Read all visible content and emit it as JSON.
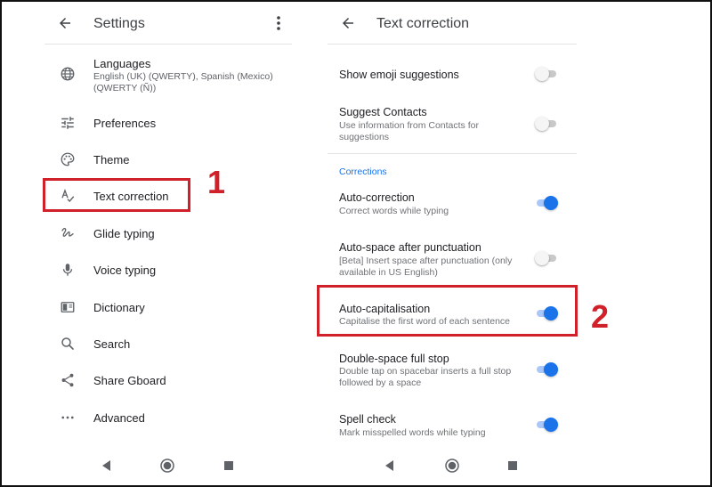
{
  "left": {
    "title": "Settings",
    "languages": {
      "label": "Languages",
      "sub": "English (UK) (QWERTY), Spanish (Mexico) (QWERTY (Ñ))"
    },
    "items": [
      {
        "label": "Preferences",
        "icon": "tune-icon"
      },
      {
        "label": "Theme",
        "icon": "palette-icon"
      },
      {
        "label": "Text correction",
        "icon": "spellcheck-icon"
      },
      {
        "label": "Glide typing",
        "icon": "gesture-icon"
      },
      {
        "label": "Voice typing",
        "icon": "microphone-icon"
      },
      {
        "label": "Dictionary",
        "icon": "book-icon"
      },
      {
        "label": "Search",
        "icon": "search-icon"
      },
      {
        "label": "Share Gboard",
        "icon": "share-icon"
      },
      {
        "label": "Advanced",
        "icon": "more-horizontal-icon"
      }
    ]
  },
  "right": {
    "title": "Text correction",
    "settings": [
      {
        "title": "Show emoji suggestions",
        "sub": "",
        "on": false
      },
      {
        "title": "Suggest Contacts",
        "sub": "Use information from Contacts for suggestions",
        "on": false
      },
      {
        "title": "Auto-correction",
        "sub": "Correct words while typing",
        "on": true
      },
      {
        "title": "Auto-space after punctuation",
        "sub": "[Beta] Insert space after punctuation (only available in US English)",
        "on": false
      },
      {
        "title": "Auto-capitalisation",
        "sub": "Capitalise the first word of each sentence",
        "on": true
      },
      {
        "title": "Double-space full stop",
        "sub": "Double tap on spacebar inserts a full stop followed by a space",
        "on": true
      },
      {
        "title": "Spell check",
        "sub": "Mark misspelled words while typing",
        "on": true
      }
    ],
    "section": "Corrections"
  },
  "annotations": {
    "step1": "1",
    "step2": "2",
    "color": "#d0202a"
  },
  "colors": {
    "accent": "#1a73e8",
    "highlight": "#d0202a"
  }
}
